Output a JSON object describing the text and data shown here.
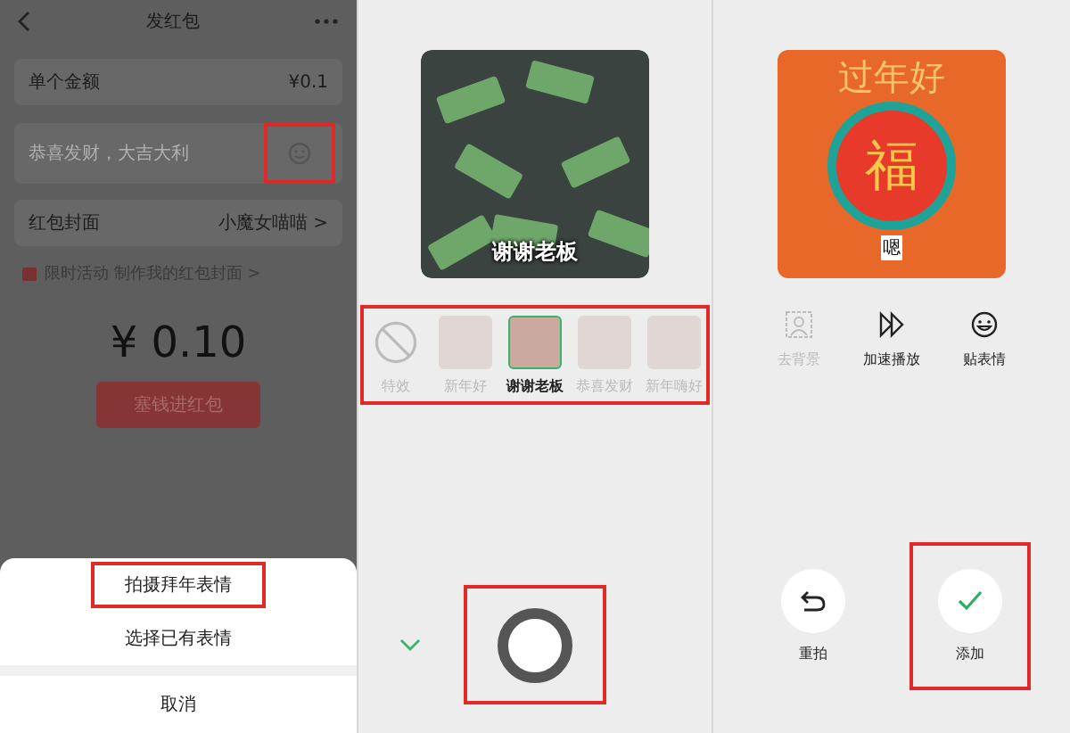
{
  "send_screen": {
    "title": "发红包",
    "amount_row": {
      "label": "单个金额",
      "value": "¥0.1"
    },
    "greeting_field": {
      "placeholder": "恭喜发财，大吉大利",
      "emoji_highlighted": true
    },
    "cover_row": {
      "label": "红包封面",
      "value": "小魔女喵喵 >"
    },
    "promo": "限时活动 制作我的红包封面 >",
    "total": "¥ 0.10",
    "submit_button": "塞钱进红包",
    "action_sheet": [
      {
        "label": "拍摄拜年表情",
        "kind": "option",
        "highlighted": true
      },
      {
        "label": "选择已有表情",
        "kind": "option",
        "highlighted": false
      },
      {
        "label": "取消",
        "kind": "cancel"
      }
    ]
  },
  "camera_screen": {
    "preview_caption": "谢谢老板",
    "effects_highlighted": true,
    "effects": [
      {
        "label": "特效",
        "kind": "none",
        "selected": false
      },
      {
        "label": "新年好",
        "kind": "thumb",
        "selected": false
      },
      {
        "label": "谢谢老板",
        "kind": "thumb",
        "selected": true
      },
      {
        "label": "恭喜发财",
        "kind": "thumb",
        "selected": false
      },
      {
        "label": "新年嗨好",
        "kind": "thumb",
        "selected": false
      }
    ],
    "shutter_highlighted": true
  },
  "result_screen": {
    "sticker": {
      "title": "过年好",
      "center": "福",
      "caption": "嗯"
    },
    "tools": [
      {
        "label": "去背景",
        "disabled": true
      },
      {
        "label": "加速播放",
        "disabled": false
      },
      {
        "label": "贴表情",
        "disabled": false
      }
    ],
    "actions": [
      {
        "label": "重拍",
        "highlighted": false
      },
      {
        "label": "添加",
        "highlighted": true
      }
    ]
  }
}
